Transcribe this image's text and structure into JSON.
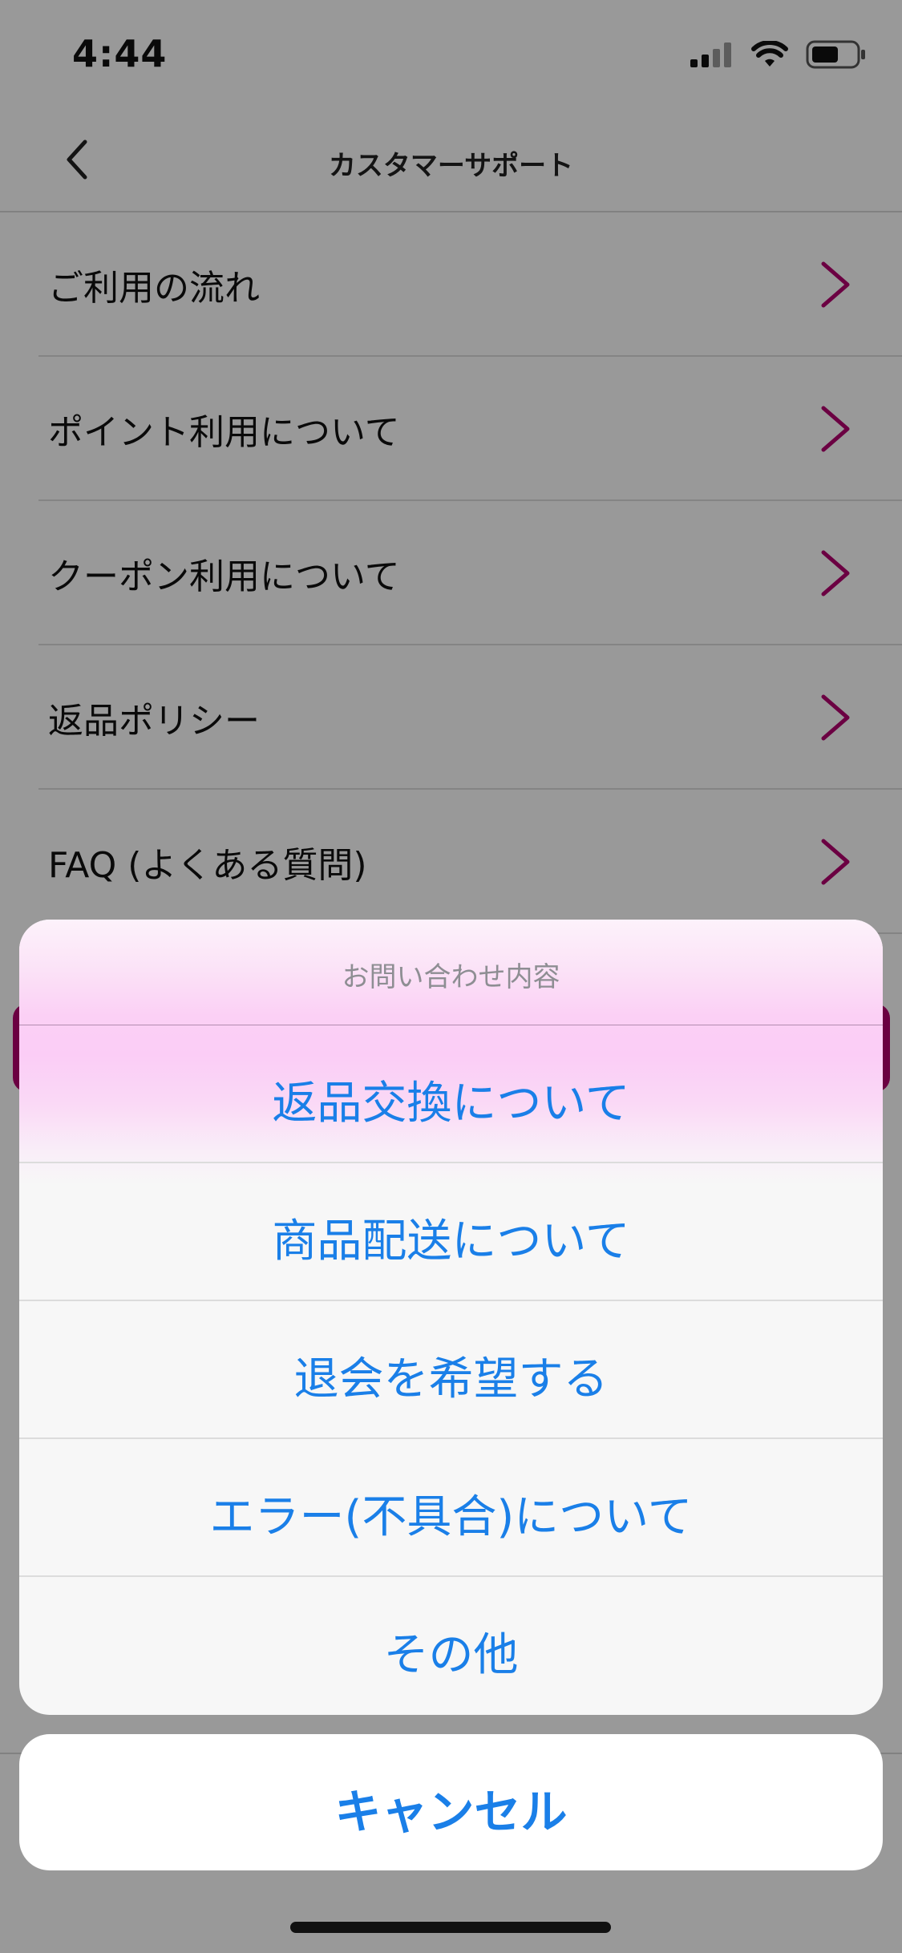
{
  "status_bar": {
    "time": "4:44"
  },
  "nav": {
    "title": "カスタマーサポート"
  },
  "menu": {
    "items": [
      {
        "label": "ご利用の流れ"
      },
      {
        "label": "ポイント利用について"
      },
      {
        "label": "クーポン利用について"
      },
      {
        "label": "返品ポリシー"
      },
      {
        "label": "FAQ (よくある質問)"
      }
    ]
  },
  "action_sheet": {
    "title": "お問い合わせ内容",
    "options": [
      {
        "label": "返品交換について"
      },
      {
        "label": "商品配送について"
      },
      {
        "label": "退会を希望する"
      },
      {
        "label": "エラー(不具合)について"
      },
      {
        "label": "その他"
      }
    ],
    "cancel_label": "キャンセル"
  },
  "colors": {
    "accent_pink": "#b3006e",
    "action_blue": "#1a7fe8"
  }
}
